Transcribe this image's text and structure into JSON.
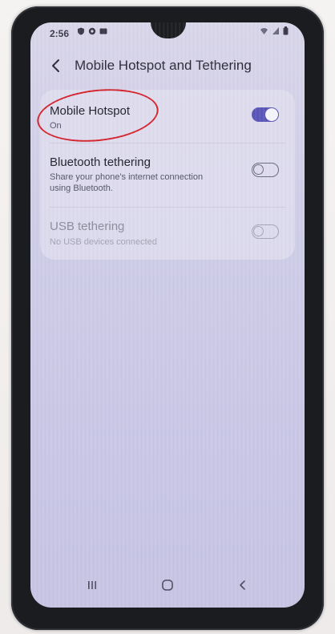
{
  "status_bar": {
    "time": "2:56",
    "left_icons": [
      "shield-icon",
      "record-icon",
      "image-icon"
    ],
    "right_icons": [
      "wifi-icon",
      "signal-icon",
      "battery-icon"
    ]
  },
  "header": {
    "title": "Mobile Hotspot and Tethering"
  },
  "settings": {
    "items": [
      {
        "title": "Mobile Hotspot",
        "subtitle": "On",
        "enabled": true,
        "toggle_state": "on"
      },
      {
        "title": "Bluetooth tethering",
        "subtitle": "Share your phone's internet connection using Bluetooth.",
        "enabled": true,
        "toggle_state": "off"
      },
      {
        "title": "USB tethering",
        "subtitle": "No USB devices connected",
        "enabled": false,
        "toggle_state": "off"
      }
    ]
  },
  "nav": {
    "recents_icon": "recents-icon",
    "home_icon": "home-icon",
    "back_icon": "back-icon"
  },
  "colors": {
    "accent": "#5a55b8",
    "annotation": "#d4242e"
  }
}
